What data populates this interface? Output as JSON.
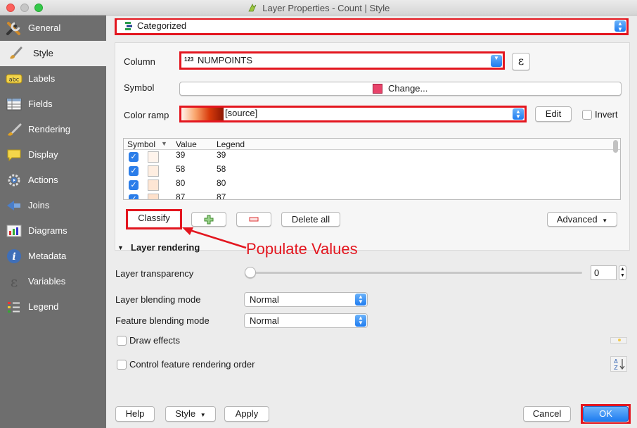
{
  "window": {
    "title": "Layer Properties - Count | Style"
  },
  "sidebar": {
    "items": [
      {
        "label": "General",
        "icon": "tools-icon"
      },
      {
        "label": "Style",
        "icon": "paintbrush-icon"
      },
      {
        "label": "Labels",
        "icon": "abc-label-icon"
      },
      {
        "label": "Fields",
        "icon": "table-fields-icon"
      },
      {
        "label": "Rendering",
        "icon": "brush-icon"
      },
      {
        "label": "Display",
        "icon": "speech-bubble-icon"
      },
      {
        "label": "Actions",
        "icon": "gear-actions-icon"
      },
      {
        "label": "Joins",
        "icon": "join-icon"
      },
      {
        "label": "Diagrams",
        "icon": "diagram-icon"
      },
      {
        "label": "Metadata",
        "icon": "info-icon"
      },
      {
        "label": "Variables",
        "icon": "epsilon-icon"
      },
      {
        "label": "Legend",
        "icon": "legend-icon"
      }
    ],
    "active": "Style"
  },
  "renderer": {
    "type_value": "Categorized"
  },
  "column": {
    "label": "Column",
    "type_badge": "123",
    "value": "NUMPOINTS",
    "expression_button": "ε"
  },
  "symbol": {
    "label": "Symbol",
    "change_button": "Change...",
    "color": "#e8436a"
  },
  "color_ramp": {
    "label": "Color ramp",
    "value": "[source]",
    "edit_button": "Edit",
    "invert_label": "Invert"
  },
  "categories": {
    "headers": [
      "Symbol",
      "Value",
      "Legend"
    ],
    "rows": [
      {
        "value": "39",
        "legend": "39",
        "checked": true
      },
      {
        "value": "58",
        "legend": "58",
        "checked": true
      },
      {
        "value": "80",
        "legend": "80",
        "checked": true
      },
      {
        "value": "87",
        "legend": "87",
        "checked": true
      }
    ]
  },
  "actions": {
    "classify": "Classify",
    "add_icon": "plus-icon",
    "remove_icon": "minus-icon",
    "delete_all": "Delete all",
    "advanced": "Advanced"
  },
  "annotation": {
    "text": "Populate Values",
    "color": "#e3161f"
  },
  "layer_rendering": {
    "section_title": "Layer rendering",
    "transparency_label": "Layer transparency",
    "transparency_value": "0",
    "blending_label": "Layer blending mode",
    "blending_value": "Normal",
    "feature_blending_label": "Feature blending mode",
    "feature_blending_value": "Normal",
    "draw_effects_label": "Draw effects",
    "control_order_label": "Control feature rendering order"
  },
  "footer": {
    "help": "Help",
    "style": "Style",
    "apply": "Apply",
    "cancel": "Cancel",
    "ok": "OK"
  },
  "colors": {
    "highlight": "#e3161f",
    "accent_blue": "#1f7cf0",
    "sidebar_bg": "#6e6e6e"
  }
}
